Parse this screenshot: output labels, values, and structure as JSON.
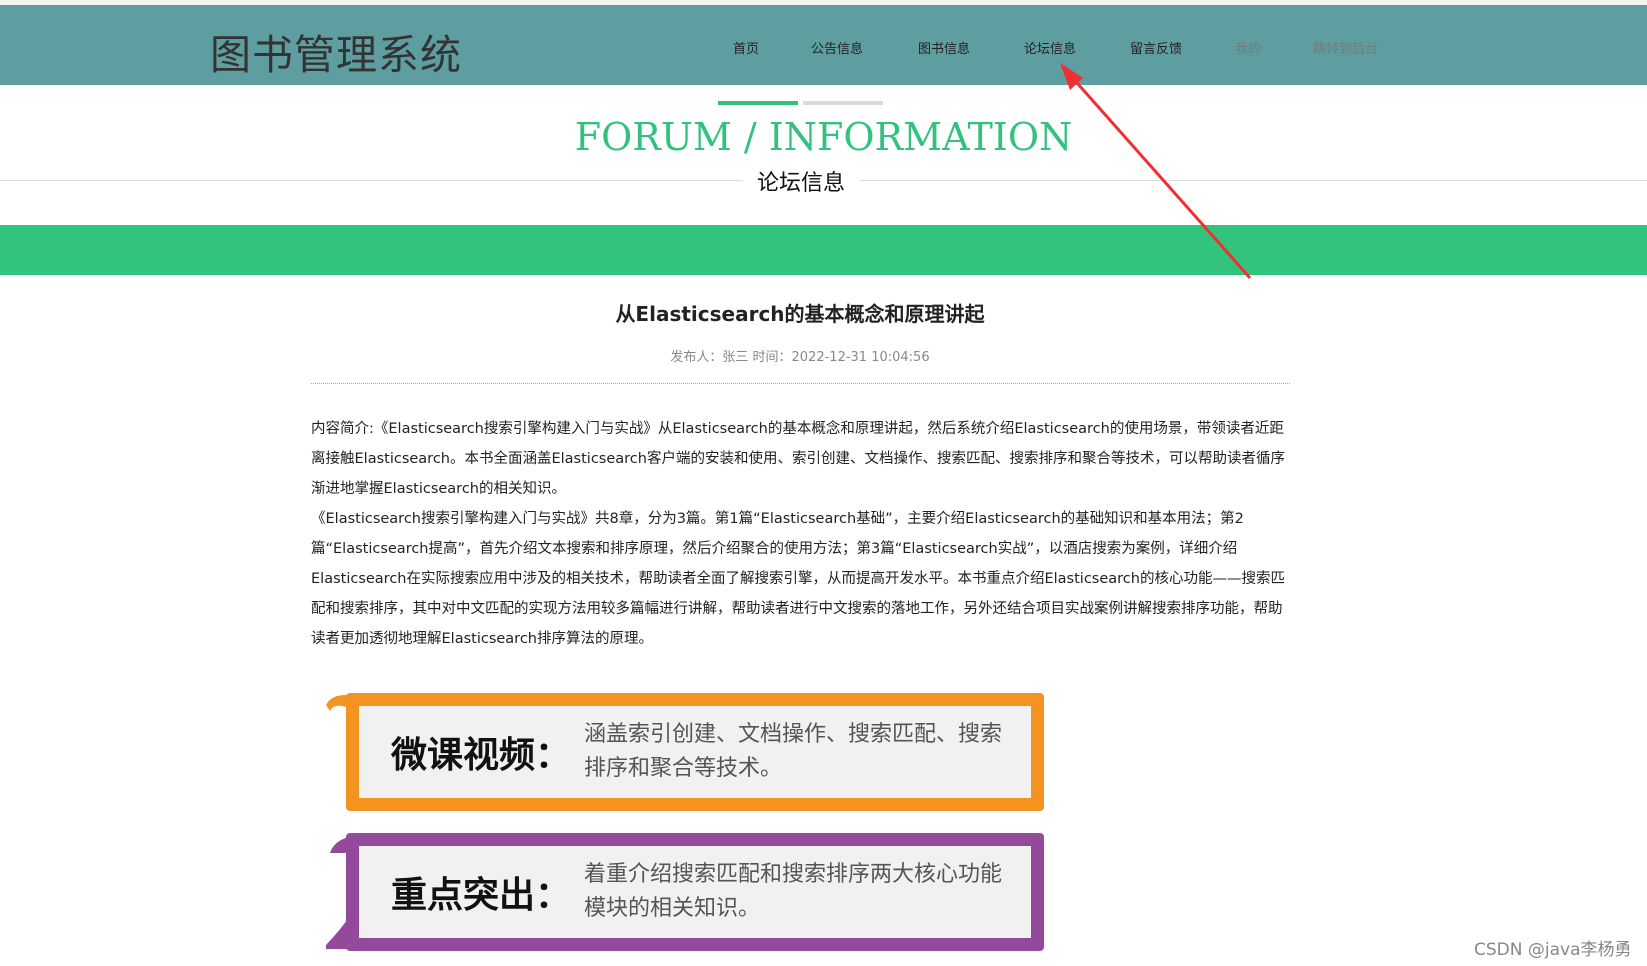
{
  "header": {
    "logo": "图书管理系统",
    "nav": [
      "首页",
      "公告信息",
      "图书信息",
      "论坛信息",
      "留言反馈",
      "我的",
      "跳转到后台"
    ]
  },
  "section": {
    "en_title": "FORUM / INFORMATION",
    "cn_title": "论坛信息"
  },
  "article": {
    "title": "从Elasticsearch的基本概念和原理讲起",
    "meta": "发布人：张三 时间：2022-12-31 10:04:56",
    "paragraphs": [
      "内容简介:《Elasticsearch搜索引擎构建入门与实战》从Elasticsearch的基本概念和原理讲起，然后系统介绍Elasticsearch的使用场景，带领读者近距离接触Elasticsearch。本书全面涵盖Elasticsearch客户端的安装和使用、索引创建、文档操作、搜索匹配、搜索排序和聚合等技术，可以帮助读者循序渐进地掌握Elasticsearch的相关知识。",
      "《Elasticsearch搜索引擎构建入门与实战》共8章，分为3篇。第1篇“Elasticsearch基础”，主要介绍Elasticsearch的基础知识和基本用法；第2篇“Elasticsearch提高”，首先介绍文本搜索和排序原理，然后介绍聚合的使用方法；第3篇“Elasticsearch实战”，以酒店搜索为案例，详细介绍Elasticsearch在实际搜索应用中涉及的相关技术，帮助读者全面了解搜索引擎，从而提高开发水平。本书重点介绍Elasticsearch的核心功能——搜索匹配和搜索排序，其中对中文匹配的实现方法用较多篇幅进行讲解，帮助读者进行中文搜索的落地工作，另外还结合项目实战案例讲解搜索排序功能，帮助读者更加透彻地理解Elasticsearch排序算法的原理。"
    ],
    "promos": [
      {
        "key": "微课视频：",
        "text": "涵盖索引创建、文档操作、搜索匹配、搜索排序和聚合等技术。",
        "color": "#f39322"
      },
      {
        "key": "重点突出：",
        "text": "着重介绍搜索匹配和搜索排序两大核心功能模块的相关知识。",
        "color": "#934a9a"
      }
    ]
  },
  "watermark": "CSDN @java李杨勇",
  "colors": {
    "header": "#5f9ea0",
    "accent": "#32c47c",
    "arrow": "#f03030"
  }
}
